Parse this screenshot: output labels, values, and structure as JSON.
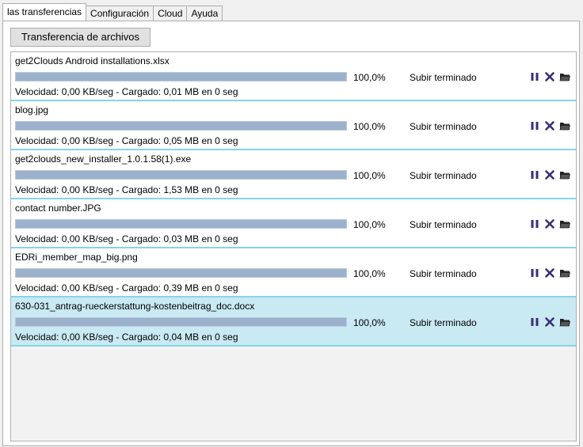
{
  "tabs": [
    {
      "label": "las transferencias",
      "active": true
    },
    {
      "label": "Configuración",
      "active": false
    },
    {
      "label": "Cloud",
      "active": false
    },
    {
      "label": "Ayuda",
      "active": false
    }
  ],
  "toolbar": {
    "transfer_button_label": "Transferencia de archivos"
  },
  "icons": {
    "pause": "pause-icon",
    "cancel": "close-icon",
    "open_folder": "folder-icon"
  },
  "colors": {
    "progress_fill": "#9bb1cc",
    "item_separator": "#86d4e6",
    "selected_row": "#c9e9f3",
    "icon_accent": "#3b2d7a"
  },
  "transfers": [
    {
      "filename": "get2Clouds Android installations.xlsx",
      "progress": 1.0,
      "percent": "100,0%",
      "status": "Subir terminado",
      "speed": "Velocidad: 0,00 KB/seg - Cargado: 0,01 MB en 0 seg",
      "selected": false
    },
    {
      "filename": "blog.jpg",
      "progress": 1.0,
      "percent": "100,0%",
      "status": "Subir terminado",
      "speed": "Velocidad: 0,00 KB/seg - Cargado: 0,05 MB en 0 seg",
      "selected": false
    },
    {
      "filename": "get2clouds_new_installer_1.0.1.58(1).exe",
      "progress": 1.0,
      "percent": "100,0%",
      "status": "Subir terminado",
      "speed": "Velocidad: 0,00 KB/seg - Cargado: 1,53 MB en 0 seg",
      "selected": false
    },
    {
      "filename": "contact number.JPG",
      "progress": 1.0,
      "percent": "100,0%",
      "status": "Subir terminado",
      "speed": "Velocidad: 0,00 KB/seg - Cargado: 0,03 MB en 0 seg",
      "selected": false
    },
    {
      "filename": "EDRi_member_map_big.png",
      "progress": 1.0,
      "percent": "100,0%",
      "status": "Subir terminado",
      "speed": "Velocidad: 0,00 KB/seg - Cargado: 0,39 MB en 0 seg",
      "selected": false
    },
    {
      "filename": "630-031_antrag-rueckerstattung-kostenbeitrag_doc.docx",
      "progress": 1.0,
      "percent": "100,0%",
      "status": "Subir terminado",
      "speed": "Velocidad: 0,00 KB/seg - Cargado: 0,04 MB en 0 seg",
      "selected": true
    }
  ]
}
